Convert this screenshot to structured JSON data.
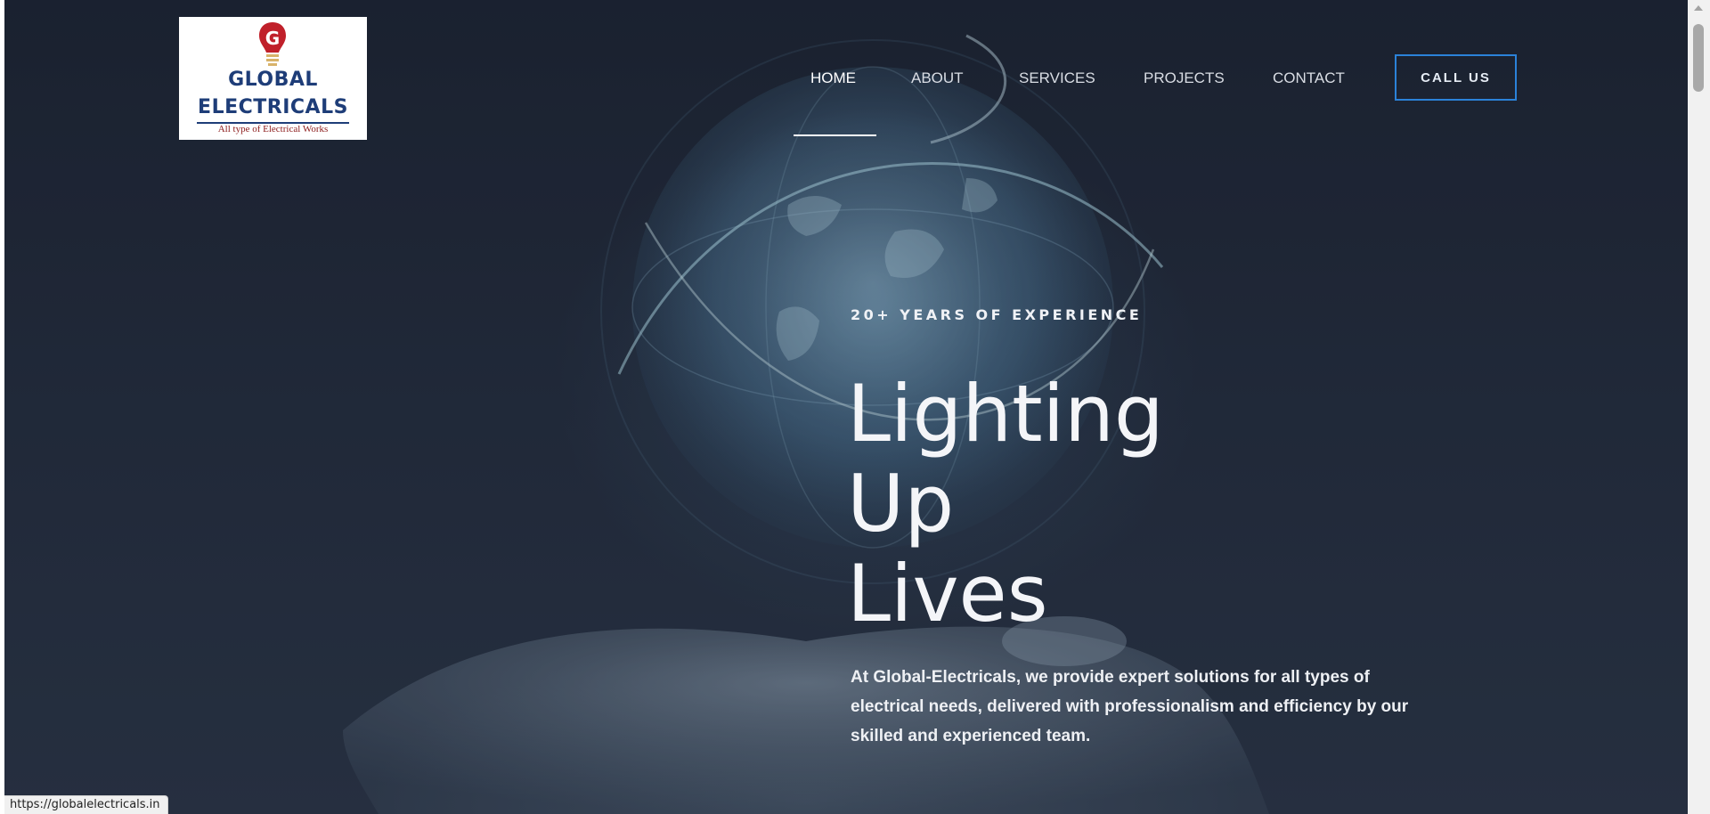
{
  "logo": {
    "line1": "GLOBAL",
    "line2": "ELECTRICALS",
    "tagline": "All type of Electrical Works"
  },
  "nav": {
    "items": [
      {
        "label": "HOME",
        "active": true
      },
      {
        "label": "ABOUT",
        "active": false
      },
      {
        "label": "SERVICES",
        "active": false
      },
      {
        "label": "PROJECTS",
        "active": false
      },
      {
        "label": "CONTACT",
        "active": false
      }
    ],
    "cta_label": "CALL US"
  },
  "hero": {
    "eyebrow": "20+ YEARS OF EXPERIENCE",
    "headline_lines": [
      "Lighting",
      "Up",
      "Lives"
    ],
    "description": "At Global-Electricals, we provide expert solutions for all types of electrical needs, delivered with professionalism and efficiency by our skilled and experienced team."
  },
  "status_bar": {
    "url": "https://globalelectricals.in"
  },
  "colors": {
    "hero_bg": "#1f2735",
    "cta_border": "#2b82d9",
    "logo_blue": "#1e3d78",
    "logo_red": "#c0202a"
  },
  "icons": {
    "logo_mark": "bulb-g-icon"
  }
}
